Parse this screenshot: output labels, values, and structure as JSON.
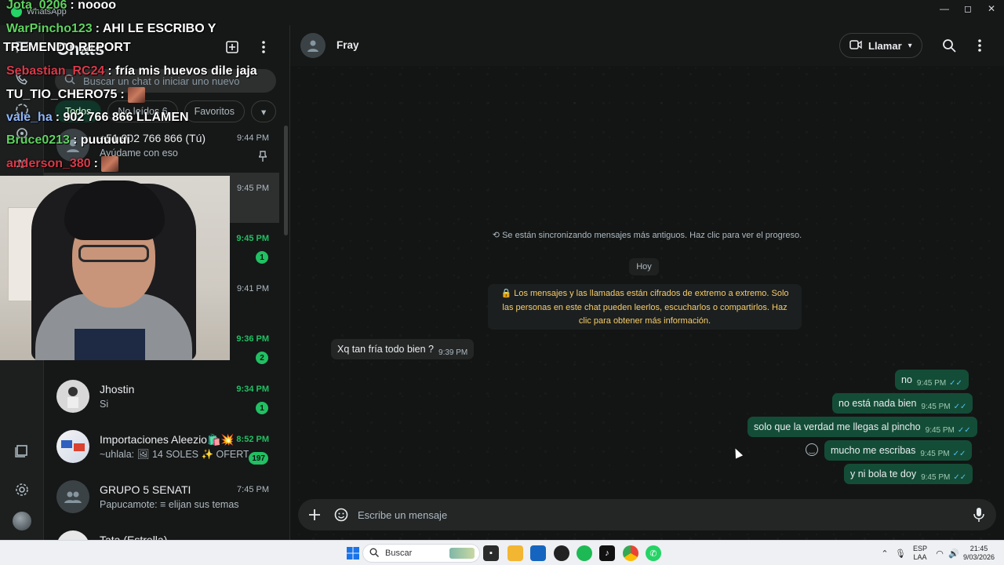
{
  "window": {
    "app_name": "WhatsApp",
    "minimize": "—",
    "maximize": "◻",
    "close": "✕"
  },
  "list": {
    "title": "Chats",
    "search_placeholder": "Buscar un chat o iniciar uno nuevo",
    "filters": [
      "Todos",
      "No leídos 6",
      "Favoritos"
    ],
    "chats": [
      {
        "name": "+51 902 766 866 (Tú)",
        "preview": "Ayúdame con eso",
        "time": "9:44 PM",
        "unread": false,
        "badge": "",
        "pinned": true
      },
      {
        "name": "",
        "preview": "",
        "time": "9:45 PM",
        "unread": false,
        "badge": "",
        "pinned": false
      },
      {
        "name": "",
        "preview": "",
        "time": "9:45 PM",
        "unread": true,
        "badge": "1",
        "pinned": false
      },
      {
        "name": "",
        "preview": "",
        "time": "9:41 PM",
        "unread": false,
        "badge": "",
        "pinned": false
      },
      {
        "name": "",
        "preview": "",
        "time": "9:36 PM",
        "unread": true,
        "badge": "2",
        "pinned": false
      },
      {
        "name": "Jhostin",
        "preview": "Si",
        "time": "9:34 PM",
        "unread": true,
        "badge": "1",
        "pinned": false
      },
      {
        "name": "Importaciones Aleezio🛍️💥",
        "preview": "~uhlala: 🖼 14 SOLES ✨ OFERTA...",
        "time": "8:52 PM",
        "unread": true,
        "badge": "197",
        "pinned": false
      },
      {
        "name": "GRUPO 5 SENATI",
        "preview": "Papucamote: ≡ elijan sus temas",
        "time": "7:45 PM",
        "unread": false,
        "badge": "",
        "pinned": false
      },
      {
        "name": "Tata (Estrella)",
        "preview": "",
        "time": "",
        "unread": false,
        "badge": "",
        "pinned": false
      }
    ]
  },
  "chat": {
    "contact_name": "Fray",
    "call_label": "Llamar",
    "sync_note": "Se están sincronizando mensajes más antiguos. Haz clic para ver el progreso.",
    "day_label": "Hoy",
    "encryption_note": "Los mensajes y las llamadas están cifrados de extremo a extremo. Solo las personas en este chat pueden leerlos, escucharlos o compartirlos. Haz clic para obtener más información.",
    "messages": [
      {
        "dir": "in",
        "text": "Xq tan fría todo bien ?",
        "time": "9:39 PM"
      },
      {
        "dir": "out",
        "text": "no",
        "time": "9:45 PM"
      },
      {
        "dir": "out",
        "text": "no está nada bien",
        "time": "9:45 PM"
      },
      {
        "dir": "out",
        "text": "solo que la verdad me llegas al pincho",
        "time": "9:45 PM"
      },
      {
        "dir": "out",
        "text": "mucho me escribas",
        "time": "9:45 PM"
      },
      {
        "dir": "out",
        "text": "y ni bola te doy",
        "time": "9:45 PM"
      }
    ],
    "composer_placeholder": "Escribe un mensaje"
  },
  "overlay": {
    "lines": [
      {
        "user": "Jota_0206",
        "sep": ":",
        "text": "noooo",
        "color": "#5fd35f"
      },
      {
        "user": "WarPincho123",
        "sep": ":",
        "text": "AHI LE ESCRIBO Y",
        "color": "#5fd35f"
      },
      {
        "user": "",
        "sep": "",
        "text": "TREMENDO REPORT",
        "color": "#ffffff"
      },
      {
        "user": "Sebastian_RC24",
        "sep": ":",
        "text": "fría mis huevos dile jaja",
        "color": "#d93a4a"
      },
      {
        "user": "TU_TIO_CHERO75",
        "sep": ":",
        "text": "",
        "color": "#ffffff"
      },
      {
        "user": "vale_ha",
        "sep": ":",
        "text": "902 766 866 LLAMEN",
        "color": "#8fb8ff"
      },
      {
        "user": "Bruce0213",
        "sep": ":",
        "text": "puuuuui",
        "color": "#5fd35f"
      },
      {
        "user": "anderson_380",
        "sep": ":",
        "text": "",
        "color": "#d93a4a"
      }
    ]
  },
  "taskbar": {
    "search_label": "Buscar",
    "lang_top": "ESP",
    "lang_bottom": "LAA",
    "time": "21:45",
    "date": "9/03/2026"
  },
  "colors": {
    "accent": "#21c063",
    "outgoing_bubble": "#144d37",
    "incoming_bubble": "#242626",
    "encryption_text": "#f7cd6b"
  }
}
